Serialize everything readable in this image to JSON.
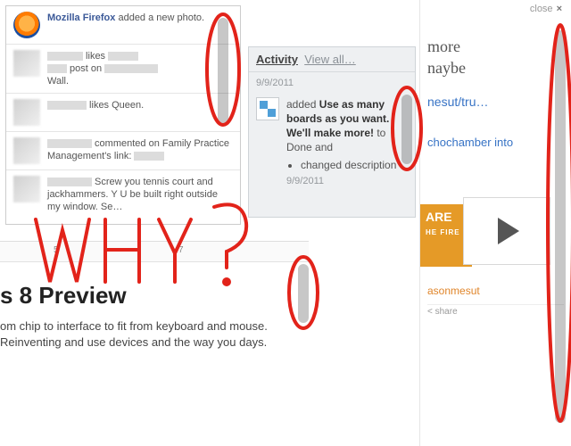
{
  "facebook": {
    "items": [
      {
        "avatar": "firefox",
        "name": "Mozilla Firefox",
        "tail": " added a new photo."
      },
      {
        "avatar": "blur",
        "tail": " post on ",
        "after": " Wall.",
        "likes_label": " likes "
      },
      {
        "avatar": "blur",
        "tail": " likes Queen."
      },
      {
        "avatar": "blur",
        "tail": " commented on Family Practice Management's link: "
      },
      {
        "avatar": "blur",
        "tail": " Screw you tennis court and jackhammers. Y U be built right outside my window. Se…"
      }
    ]
  },
  "trello": {
    "title": "Activity",
    "view_all": "View all…",
    "top_date": "9/9/2011",
    "prefix": "added ",
    "card": "Use as many boards as you want. We'll make more!",
    "to": " to Done and",
    "bullet": "changed description",
    "bottom_date": "9/9/2011"
  },
  "document": {
    "ruler_5": "5",
    "ruler_7": "7",
    "heading": "s 8 Preview",
    "body": "om chip to interface to fit from keyboard and mouse. Reinventing and use devices and the way you days."
  },
  "sidebar": {
    "close": "close",
    "serif_line1": "more",
    "serif_line2": "naybe",
    "link1": "nesut/tru…",
    "link2": "chochamber into",
    "promo_big": "ARE",
    "promo_small": "HE FIRE",
    "author": "asonmesut",
    "share": "< share"
  },
  "annotation": {
    "text": "WHY?"
  }
}
